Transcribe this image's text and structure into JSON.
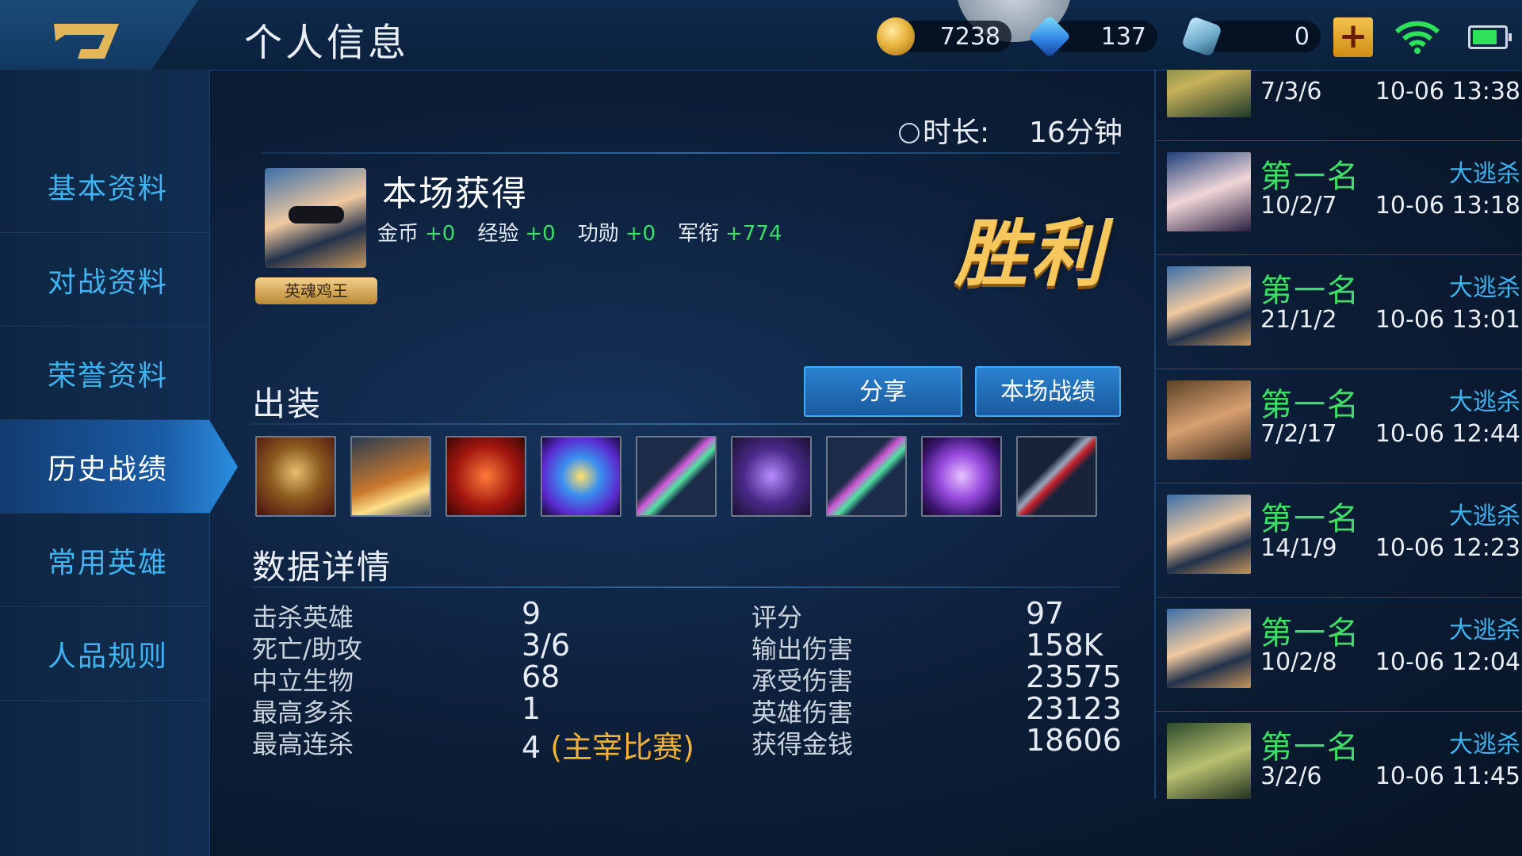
{
  "header": {
    "title": "个人信息",
    "currencies": {
      "gold": "7238",
      "diamonds": "137",
      "vouchers": "0"
    }
  },
  "sidebar": {
    "items": [
      {
        "label": "基本资料",
        "active": false
      },
      {
        "label": "对战资料",
        "active": false
      },
      {
        "label": "荣誉资料",
        "active": false
      },
      {
        "label": "历史战绩",
        "active": true
      },
      {
        "label": "常用英雄",
        "active": false
      },
      {
        "label": "人品规则",
        "active": false
      }
    ]
  },
  "match": {
    "duration_label": "时长:",
    "duration_value": "16分钟",
    "earned_title": "本场获得",
    "earned": [
      {
        "label": "金币",
        "value": "+0"
      },
      {
        "label": "经验",
        "value": "+0"
      },
      {
        "label": "功勋",
        "value": "+0"
      },
      {
        "label": "军衔",
        "value": "+774"
      }
    ],
    "hero_title": "英魂鸡王",
    "result": "胜利",
    "equipment_title": "出装",
    "share_label": "分享",
    "record_label": "本场战绩",
    "items": [
      {
        "name": "armor-mask-icon"
      },
      {
        "name": "boots-icon"
      },
      {
        "name": "demon-mask-icon"
      },
      {
        "name": "lightning-orb-icon"
      },
      {
        "name": "green-sword-icon"
      },
      {
        "name": "purple-armor-icon"
      },
      {
        "name": "green-sword-icon"
      },
      {
        "name": "purple-orb-icon"
      },
      {
        "name": "red-blade-icon"
      }
    ],
    "data_title": "数据详情",
    "stats_left": [
      {
        "label": "击杀英雄",
        "value": "9"
      },
      {
        "label": "死亡/助攻",
        "value": "3/6"
      },
      {
        "label": "中立生物",
        "value": "68"
      },
      {
        "label": "最高多杀",
        "value": "1"
      },
      {
        "label": "最高连杀",
        "value": "4",
        "note": "(主宰比赛)"
      }
    ],
    "stats_right": [
      {
        "label": "评分",
        "value": "97"
      },
      {
        "label": "输出伤害",
        "value": "158K"
      },
      {
        "label": "承受伤害",
        "value": "23575"
      },
      {
        "label": "英雄伤害",
        "value": "23123"
      },
      {
        "label": "获得金钱",
        "value": "18606"
      }
    ]
  },
  "history": [
    {
      "rank": "",
      "mode": "",
      "kda": "7/3/6",
      "time": "10-06 13:38"
    },
    {
      "rank": "第一名",
      "mode": "大逃杀",
      "kda": "10/2/7",
      "time": "10-06 13:18"
    },
    {
      "rank": "第一名",
      "mode": "大逃杀",
      "kda": "21/1/2",
      "time": "10-06 13:01"
    },
    {
      "rank": "第一名",
      "mode": "大逃杀",
      "kda": "7/2/17",
      "time": "10-06 12:44"
    },
    {
      "rank": "第一名",
      "mode": "大逃杀",
      "kda": "14/1/9",
      "time": "10-06 12:23"
    },
    {
      "rank": "第一名",
      "mode": "大逃杀",
      "kda": "10/2/8",
      "time": "10-06 12:04"
    },
    {
      "rank": "第一名",
      "mode": "大逃杀",
      "kda": "3/2/6",
      "time": "10-06 11:45"
    }
  ]
}
